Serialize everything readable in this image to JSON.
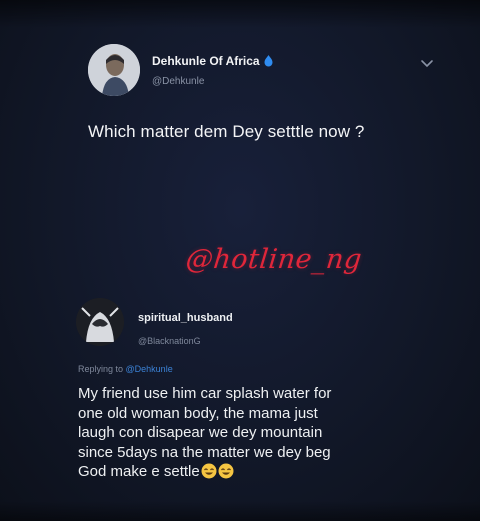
{
  "tweet": {
    "author_name": "Dehkunle Of Africa",
    "handle": "@Dehkunle",
    "text": "Which matter dem Dey setttle now ?",
    "verified_icon": "verified-badge-icon",
    "menu_icon": "chevron-down-icon"
  },
  "watermark": {
    "text": "@hotline_ng",
    "color": "#e0263a"
  },
  "reply": {
    "author_name": "spiritual_husband",
    "handle": "@BlacknationG",
    "replying_prefix": "Replying to ",
    "replying_mention": "@Dehkunle",
    "text": "My friend use him car splash water for\none old woman body, the mama just\nlaugh con disapear we dey mountain\nsince 5days na the matter we dey beg\nGod make e settle",
    "emojis": [
      "laughing-face-emoji",
      "laughing-face-emoji"
    ]
  },
  "colors": {
    "background": "#101521",
    "link": "#3b82d6",
    "secondary_text": "#8a93a6"
  }
}
